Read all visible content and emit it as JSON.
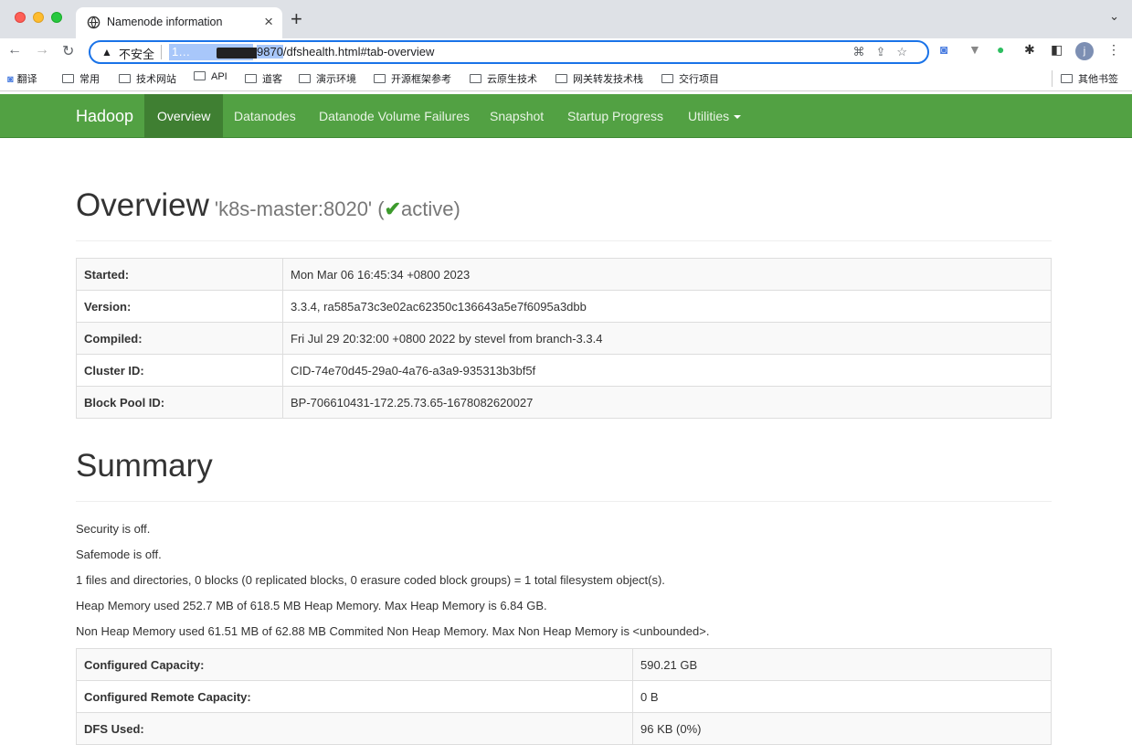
{
  "browser": {
    "tab_title": "Namenode information",
    "tab_close": "×",
    "new_tab": "+",
    "tab_search": "⌄",
    "back": "←",
    "forward": "→",
    "reload": "↻",
    "insecure_label": "不安全",
    "url_host_fragment": "1…",
    "url_port": "9870",
    "url_path": "/dfshealth.html#tab-overview",
    "profile_initial": "j",
    "bookmarks": [
      "翻译",
      "常用",
      "技术网站",
      "API",
      "道客",
      "演示环境",
      "开源框架参考",
      "云原生技术",
      "网关转发技术栈",
      "交行项目"
    ],
    "other_bookmarks": "其他书签"
  },
  "navbar": {
    "brand": "Hadoop",
    "items": [
      "Overview",
      "Datanodes",
      "Datanode Volume Failures",
      "Snapshot",
      "Startup Progress",
      "Utilities"
    ],
    "active": "Overview"
  },
  "overview": {
    "title": "Overview",
    "host": "'k8s-master:8020'",
    "status_open": "(",
    "check": "✔",
    "status": "active",
    "status_close": ")",
    "rows": [
      {
        "key": "Started:",
        "value": "Mon Mar 06 16:45:34 +0800 2023"
      },
      {
        "key": "Version:",
        "value": "3.3.4, ra585a73c3e02ac62350c136643a5e7f6095a3dbb"
      },
      {
        "key": "Compiled:",
        "value": "Fri Jul 29 20:32:00 +0800 2022 by stevel from branch-3.3.4"
      },
      {
        "key": "Cluster ID:",
        "value": "CID-74e70d45-29a0-4a76-a3a9-935313b3bf5f"
      },
      {
        "key": "Block Pool ID:",
        "value": "BP-706610431-172.25.73.65-1678082620027"
      }
    ]
  },
  "summary": {
    "title": "Summary",
    "lines": [
      "Security is off.",
      "Safemode is off.",
      "1 files and directories, 0 blocks (0 replicated blocks, 0 erasure coded block groups) = 1 total filesystem object(s).",
      "Heap Memory used 252.7 MB of 618.5 MB Heap Memory. Max Heap Memory is 6.84 GB.",
      "Non Heap Memory used 61.51 MB of 62.88 MB Commited Non Heap Memory. Max Non Heap Memory is <unbounded>."
    ],
    "rows": [
      {
        "key": "Configured Capacity:",
        "value": "590.21 GB"
      },
      {
        "key": "Configured Remote Capacity:",
        "value": "0 B"
      },
      {
        "key": "DFS Used:",
        "value": "96 KB (0%)"
      }
    ]
  }
}
